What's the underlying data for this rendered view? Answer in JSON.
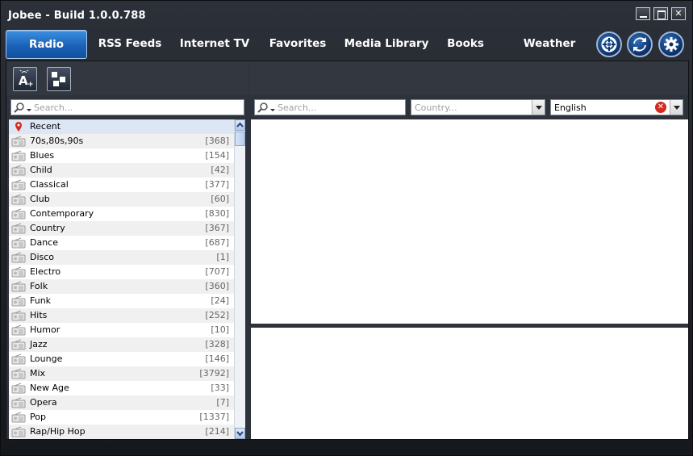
{
  "window": {
    "title": "Jobee - Build 1.0.0.788"
  },
  "tabs": [
    {
      "label": "Radio"
    },
    {
      "label": "RSS Feeds"
    },
    {
      "label": "Internet TV"
    },
    {
      "label": "Favorites"
    },
    {
      "label": "Media Library"
    },
    {
      "label": "Books"
    },
    {
      "label": "Weather"
    }
  ],
  "toolbar_icons": [
    "lifebuoy-icon",
    "refresh-icon",
    "gear-icon"
  ],
  "left": {
    "search_placeholder": "Search...",
    "genres": [
      {
        "label": "Recent",
        "count": ""
      },
      {
        "label": "70s,80s,90s",
        "count": "[368]"
      },
      {
        "label": "Blues",
        "count": "[154]"
      },
      {
        "label": "Child",
        "count": "[42]"
      },
      {
        "label": "Classical",
        "count": "[377]"
      },
      {
        "label": "Club",
        "count": "[60]"
      },
      {
        "label": "Contemporary",
        "count": "[830]"
      },
      {
        "label": "Country",
        "count": "[367]"
      },
      {
        "label": "Dance",
        "count": "[687]"
      },
      {
        "label": "Disco",
        "count": "[1]"
      },
      {
        "label": "Electro",
        "count": "[707]"
      },
      {
        "label": "Folk",
        "count": "[360]"
      },
      {
        "label": "Funk",
        "count": "[24]"
      },
      {
        "label": "Hits",
        "count": "[252]"
      },
      {
        "label": "Humor",
        "count": "[10]"
      },
      {
        "label": "Jazz",
        "count": "[328]"
      },
      {
        "label": "Lounge",
        "count": "[146]"
      },
      {
        "label": "Mix",
        "count": "[3792]"
      },
      {
        "label": "New Age",
        "count": "[33]"
      },
      {
        "label": "Opera",
        "count": "[7]"
      },
      {
        "label": "Pop",
        "count": "[1337]"
      },
      {
        "label": "Rap/Hip Hop",
        "count": "[214]"
      }
    ]
  },
  "right": {
    "search_placeholder": "Search...",
    "country_placeholder": "Country...",
    "language_value": "English"
  },
  "colors": {
    "active_tab": "#1a62b8",
    "window_bg": "#2c3038"
  }
}
